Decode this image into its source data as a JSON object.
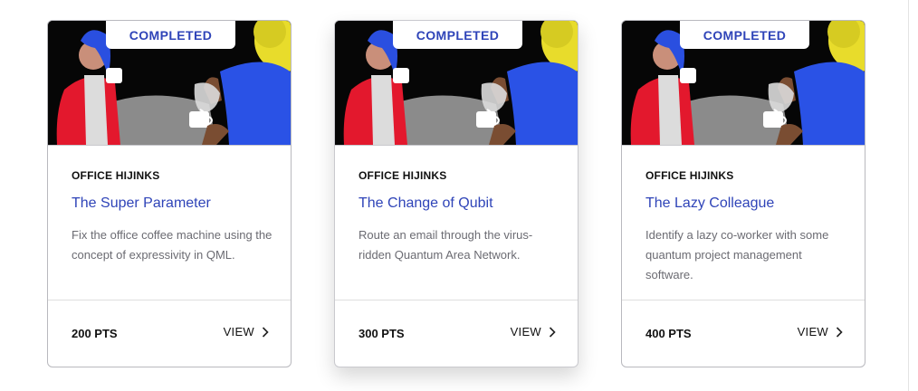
{
  "cards": [
    {
      "status": "COMPLETED",
      "category": "OFFICE HIJINKS",
      "title": "The Super Parameter",
      "description": "Fix the office coffee machine using the concept of expressivity in QML.",
      "points": "200 PTS",
      "view_label": "VIEW"
    },
    {
      "status": "COMPLETED",
      "category": "OFFICE HIJINKS",
      "title": "The Change of Qubit",
      "description": "Route an email through the virus-ridden Quantum Area Network.",
      "points": "300 PTS",
      "view_label": "VIEW"
    },
    {
      "status": "COMPLETED",
      "category": "OFFICE HIJINKS",
      "title": "The Lazy Colleague",
      "description": "Identify a lazy co-worker with some quantum project management software.",
      "points": "400 PTS",
      "view_label": "VIEW"
    }
  ],
  "icons": {
    "view": "chevron-right-icon"
  },
  "colors": {
    "accent": "#2f44b8",
    "image_bg": "#060606"
  }
}
